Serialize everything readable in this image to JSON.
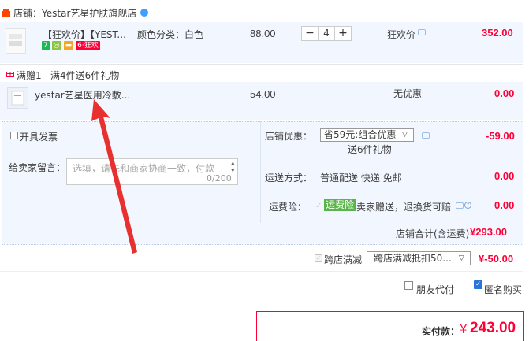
{
  "shop": {
    "label_prefix": "店铺：",
    "name": "Yestar艺星护肤旗舰店"
  },
  "item1": {
    "title": "【狂欢价】【YEST...",
    "badges": [
      {
        "text": "7",
        "color": "#19b955"
      },
      {
        "text": "◎",
        "color": "#8cc63f"
      },
      {
        "text": "▬",
        "color": "#f5a623"
      },
      {
        "text": "6·狂欢",
        "color": "#ff0036"
      }
    ],
    "sku": "颜色分类：白色",
    "price": "88.00",
    "qty_minus": "−",
    "qty": "4",
    "qty_plus": "+",
    "promo": "狂欢价",
    "total": "352.00"
  },
  "gift": {
    "label": "满赠1",
    "rule": "满4件送6件礼物"
  },
  "item2": {
    "title": "yestar艺星医用冷敷...",
    "price": "54.00",
    "promo": "无优惠",
    "total": "0.00"
  },
  "options": {
    "invoice_label": "开具发票",
    "message_label": "给卖家留言：",
    "message_placeholder": "选填，请先和商家协商一致，付款",
    "message_count": "0/200",
    "discount_label": "店铺优惠：",
    "discount_selected": "省59元:组合优惠",
    "discount_gift": "送6件礼物",
    "discount_amount": "-59.00",
    "shipping_label": "运送方式：",
    "shipping_value": "普通配送 快递 免邮",
    "shipping_amount": "0.00",
    "insurance_label": "运费险：",
    "insurance_tag": "运费险",
    "insurance_text": "卖家赠送，退换货可赔",
    "insurance_amount": "0.00",
    "subtotal_label": "店铺合计(含运费)",
    "subtotal_amount": "¥293.00"
  },
  "cross_store": {
    "label": "跨店满减",
    "selected": "跨店满减抵扣50...",
    "amount": "¥-50.00"
  },
  "checkout": {
    "proxy_label": "朋友代付",
    "anonymous_label": "匿名购买",
    "pay_label": "实付款：",
    "pay_currency": "¥",
    "pay_amount": "243.00"
  },
  "colors": {
    "price_red": "#ff0036",
    "panel_bg": "#f2f7ff",
    "insurance_green": "#59b549",
    "checkbox_blue": "#2a74d8",
    "arrow_red": "#e8312f"
  }
}
